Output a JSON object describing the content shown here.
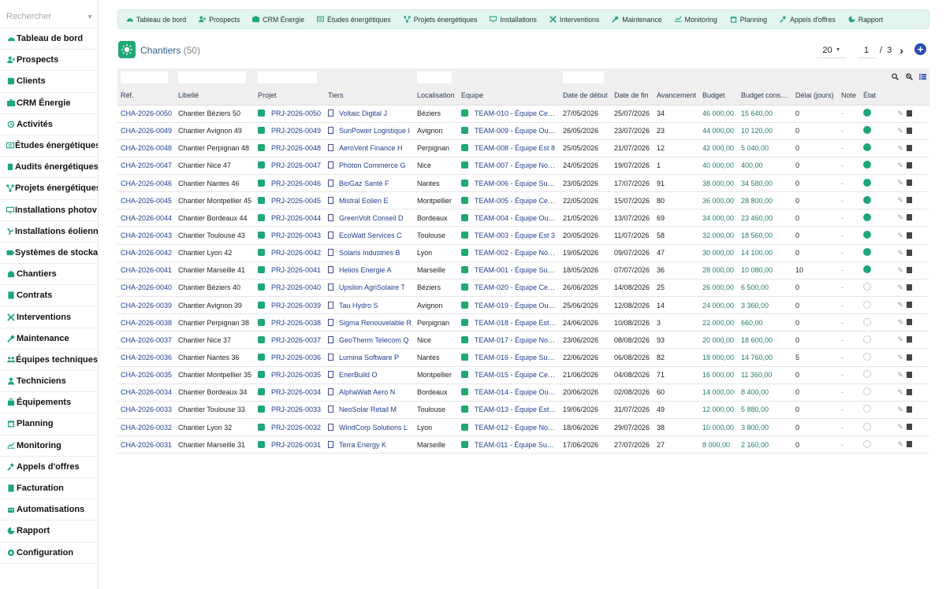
{
  "sidebar": {
    "search_placeholder": "Rechercher",
    "items": [
      {
        "label": "Tableau de bord",
        "icon": "dashboard-icon"
      },
      {
        "label": "Prospects",
        "icon": "user-plus-icon"
      },
      {
        "label": "Clients",
        "icon": "client-card-icon"
      },
      {
        "label": "CRM Énergie",
        "icon": "crm-icon"
      },
      {
        "label": "Activités",
        "icon": "history-icon"
      },
      {
        "label": "Études énergétiques",
        "icon": "study-icon"
      },
      {
        "label": "Audits énergétiques",
        "icon": "audit-icon"
      },
      {
        "label": "Projets énergétiques",
        "icon": "project-icon"
      },
      {
        "label": "Installations photov…",
        "icon": "solar-panel-icon"
      },
      {
        "label": "Installations éoliennes",
        "icon": "wind-icon"
      },
      {
        "label": "Systèmes de stockage",
        "icon": "battery-icon"
      },
      {
        "label": "Chantiers",
        "icon": "site-icon"
      },
      {
        "label": "Contrats",
        "icon": "contract-icon"
      },
      {
        "label": "Interventions",
        "icon": "tools-icon"
      },
      {
        "label": "Maintenance",
        "icon": "wrench-icon"
      },
      {
        "label": "Équipes techniques",
        "icon": "team-icon"
      },
      {
        "label": "Techniciens",
        "icon": "technician-icon"
      },
      {
        "label": "Équipements",
        "icon": "equipment-icon"
      },
      {
        "label": "Planning",
        "icon": "calendar-icon"
      },
      {
        "label": "Monitoring",
        "icon": "monitor-icon"
      },
      {
        "label": "Appels d'offres",
        "icon": "tender-icon"
      },
      {
        "label": "Facturation",
        "icon": "invoice-icon"
      },
      {
        "label": "Automatisations",
        "icon": "robot-icon"
      },
      {
        "label": "Rapport",
        "icon": "report-icon"
      },
      {
        "label": "Configuration",
        "icon": "gear-icon"
      }
    ]
  },
  "topmenu": [
    {
      "label": "Tableau de bord",
      "icon": "dashboard-icon"
    },
    {
      "label": "Prospects",
      "icon": "user-plus-icon"
    },
    {
      "label": "CRM Énergie",
      "icon": "crm-icon"
    },
    {
      "label": "Études énergétiques",
      "icon": "study-icon"
    },
    {
      "label": "Projets énergétiques",
      "icon": "project-icon"
    },
    {
      "label": "Installations",
      "icon": "solar-panel-icon"
    },
    {
      "label": "Interventions",
      "icon": "tools-icon"
    },
    {
      "label": "Maintenance",
      "icon": "wrench-icon"
    },
    {
      "label": "Monitoring",
      "icon": "monitor-icon"
    },
    {
      "label": "Planning",
      "icon": "calendar-icon"
    },
    {
      "label": "Appels d'offres",
      "icon": "tender-icon"
    },
    {
      "label": "Rapport",
      "icon": "report-icon"
    }
  ],
  "header": {
    "title": "Chantiers",
    "count": "(50)",
    "limit": "20",
    "page": "1",
    "page_sep": "/",
    "pages": "3"
  },
  "colors": {
    "accent": "#1fa774",
    "link": "#1f3f8f",
    "money": "#1d7f6d"
  },
  "table": {
    "columns": [
      "Réf.",
      "Libellé",
      "Projet",
      "Tiers",
      "Localisation",
      "Equipe",
      "Date de début",
      "Date de fin",
      "Avancement",
      "Budget",
      "Budget cons…",
      "Délai (jours)",
      "Note",
      "État"
    ],
    "rows": [
      {
        "ref": "CHA-2026-0050",
        "label": "Chantier Béziers 50",
        "project": "PRJ-2026-0050",
        "tiers": "Voltaic Digital J",
        "loc": "Béziers",
        "team": "TEAM-010 - Équipe Ce…",
        "start": "27/05/2026",
        "end": "25/07/2026",
        "progress": "34",
        "budget": "46 000,00",
        "consumed": "15 640,00",
        "delay": "0",
        "note": "-",
        "active": true
      },
      {
        "ref": "CHA-2026-0049",
        "label": "Chantier Avignon 49",
        "project": "PRJ-2026-0049",
        "tiers": "SunPower Logistique I",
        "loc": "Avignon",
        "team": "TEAM-009 - Équipe Ou…",
        "start": "26/05/2026",
        "end": "23/07/2026",
        "progress": "23",
        "budget": "44 000,00",
        "consumed": "10 120,00",
        "delay": "0",
        "note": "-",
        "active": true
      },
      {
        "ref": "CHA-2026-0048",
        "label": "Chantier Perpignan 48",
        "project": "PRJ-2026-0048",
        "tiers": "AeroVent Finance H",
        "loc": "Perpignan",
        "team": "TEAM-008 - Équipe Est 8",
        "start": "25/05/2026",
        "end": "21/07/2026",
        "progress": "12",
        "budget": "42 000,00",
        "consumed": "5 040,00",
        "delay": "0",
        "note": "-",
        "active": true
      },
      {
        "ref": "CHA-2026-0047",
        "label": "Chantier Nice 47",
        "project": "PRJ-2026-0047",
        "tiers": "Photon Commerce G",
        "loc": "Nice",
        "team": "TEAM-007 - Équipe No…",
        "start": "24/05/2026",
        "end": "19/07/2026",
        "progress": "1",
        "budget": "40 000,00",
        "consumed": "400,00",
        "delay": "0",
        "note": "-",
        "active": true
      },
      {
        "ref": "CHA-2026-0046",
        "label": "Chantier Nantes 46",
        "project": "PRJ-2026-0046",
        "tiers": "BioGaz Santé F",
        "loc": "Nantes",
        "team": "TEAM-006 - Équipe Su…",
        "start": "23/05/2026",
        "end": "17/07/2026",
        "progress": "91",
        "budget": "38 000,00",
        "consumed": "34 580,00",
        "delay": "0",
        "note": "-",
        "active": true
      },
      {
        "ref": "CHA-2026-0045",
        "label": "Chantier Montpellier 45",
        "project": "PRJ-2026-0045",
        "tiers": "Mistral Eolien E",
        "loc": "Montpellier",
        "team": "TEAM-005 - Équipe Ce…",
        "start": "22/05/2026",
        "end": "15/07/2026",
        "progress": "80",
        "budget": "36 000,00",
        "consumed": "28 800,00",
        "delay": "0",
        "note": "-",
        "active": true
      },
      {
        "ref": "CHA-2026-0044",
        "label": "Chantier Bordeaux 44",
        "project": "PRJ-2026-0044",
        "tiers": "GreenVolt Conseil D",
        "loc": "Bordeaux",
        "team": "TEAM-004 - Équipe Ou…",
        "start": "21/05/2026",
        "end": "13/07/2026",
        "progress": "69",
        "budget": "34 000,00",
        "consumed": "23 460,00",
        "delay": "0",
        "note": "-",
        "active": true
      },
      {
        "ref": "CHA-2026-0043",
        "label": "Chantier Toulouse 43",
        "project": "PRJ-2026-0043",
        "tiers": "EcoWatt Services C",
        "loc": "Toulouse",
        "team": "TEAM-003 - Équipe Est 3",
        "start": "20/05/2026",
        "end": "11/07/2026",
        "progress": "58",
        "budget": "32 000,00",
        "consumed": "18 560,00",
        "delay": "0",
        "note": "-",
        "active": true
      },
      {
        "ref": "CHA-2026-0042",
        "label": "Chantier Lyon 42",
        "project": "PRJ-2026-0042",
        "tiers": "Solaris Industries B",
        "loc": "Lyon",
        "team": "TEAM-002 - Équipe No…",
        "start": "19/05/2026",
        "end": "09/07/2026",
        "progress": "47",
        "budget": "30 000,00",
        "consumed": "14 100,00",
        "delay": "0",
        "note": "-",
        "active": true
      },
      {
        "ref": "CHA-2026-0041",
        "label": "Chantier Marseille 41",
        "project": "PRJ-2026-0041",
        "tiers": "Helios Energie A",
        "loc": "Marseille",
        "team": "TEAM-001 - Équipe Su…",
        "start": "18/05/2026",
        "end": "07/07/2026",
        "progress": "36",
        "budget": "28 000,00",
        "consumed": "10 080,00",
        "delay": "10",
        "note": "-",
        "active": true
      },
      {
        "ref": "CHA-2026-0040",
        "label": "Chantier Béziers 40",
        "project": "PRJ-2026-0040",
        "tiers": "Upsilon AgriSolaire T",
        "loc": "Béziers",
        "team": "TEAM-020 - Équipe Ce…",
        "start": "26/06/2026",
        "end": "14/08/2026",
        "progress": "25",
        "budget": "26 000,00",
        "consumed": "6 500,00",
        "delay": "0",
        "note": "-",
        "active": false
      },
      {
        "ref": "CHA-2026-0039",
        "label": "Chantier Avignon 39",
        "project": "PRJ-2026-0039",
        "tiers": "Tau Hydro S",
        "loc": "Avignon",
        "team": "TEAM-019 - Équipe Ou…",
        "start": "25/06/2026",
        "end": "12/08/2026",
        "progress": "14",
        "budget": "24 000,00",
        "consumed": "3 360,00",
        "delay": "0",
        "note": "-",
        "active": false
      },
      {
        "ref": "CHA-2026-0038",
        "label": "Chantier Perpignan 38",
        "project": "PRJ-2026-0038",
        "tiers": "Sigma Renouvelable R",
        "loc": "Perpignan",
        "team": "TEAM-018 - Équipe Est…",
        "start": "24/06/2026",
        "end": "10/08/2026",
        "progress": "3",
        "budget": "22 000,00",
        "consumed": "660,00",
        "delay": "0",
        "note": "-",
        "active": false
      },
      {
        "ref": "CHA-2026-0037",
        "label": "Chantier Nice 37",
        "project": "PRJ-2026-0037",
        "tiers": "GeoTherm Telecom Q",
        "loc": "Nice",
        "team": "TEAM-017 - Équipe No…",
        "start": "23/06/2026",
        "end": "08/08/2026",
        "progress": "93",
        "budget": "20 000,00",
        "consumed": "18 600,00",
        "delay": "0",
        "note": "-",
        "active": false
      },
      {
        "ref": "CHA-2026-0036",
        "label": "Chantier Nantes 36",
        "project": "PRJ-2026-0036",
        "tiers": "Lumina Software P",
        "loc": "Nantes",
        "team": "TEAM-016 - Équipe Su…",
        "start": "22/06/2026",
        "end": "06/08/2026",
        "progress": "82",
        "budget": "18 000,00",
        "consumed": "14 760,00",
        "delay": "5",
        "note": "-",
        "active": false
      },
      {
        "ref": "CHA-2026-0035",
        "label": "Chantier Montpellier 35",
        "project": "PRJ-2026-0035",
        "tiers": "EnerBuild O",
        "loc": "Montpellier",
        "team": "TEAM-015 - Équipe Ce…",
        "start": "21/06/2026",
        "end": "04/08/2026",
        "progress": "71",
        "budget": "16 000,00",
        "consumed": "11 360,00",
        "delay": "0",
        "note": "-",
        "active": false
      },
      {
        "ref": "CHA-2026-0034",
        "label": "Chantier Bordeaux 34",
        "project": "PRJ-2026-0034",
        "tiers": "AlphaWatt Aero N",
        "loc": "Bordeaux",
        "team": "TEAM-014 - Équipe Ou…",
        "start": "20/06/2026",
        "end": "02/08/2026",
        "progress": "60",
        "budget": "14 000,00",
        "consumed": "8 400,00",
        "delay": "0",
        "note": "-",
        "active": false
      },
      {
        "ref": "CHA-2026-0033",
        "label": "Chantier Toulouse 33",
        "project": "PRJ-2026-0033",
        "tiers": "NeoSolar Retail M",
        "loc": "Toulouse",
        "team": "TEAM-013 - Équipe Est…",
        "start": "19/06/2026",
        "end": "31/07/2026",
        "progress": "49",
        "budget": "12 000,00",
        "consumed": "5 880,00",
        "delay": "0",
        "note": "-",
        "active": false
      },
      {
        "ref": "CHA-2026-0032",
        "label": "Chantier Lyon 32",
        "project": "PRJ-2026-0032",
        "tiers": "WindCorp Solutions L",
        "loc": "Lyon",
        "team": "TEAM-012 - Équipe No…",
        "start": "18/06/2026",
        "end": "29/07/2026",
        "progress": "38",
        "budget": "10 000,00",
        "consumed": "3 800,00",
        "delay": "0",
        "note": "-",
        "active": false
      },
      {
        "ref": "CHA-2026-0031",
        "label": "Chantier Marseille 31",
        "project": "PRJ-2026-0031",
        "tiers": "Terra Energy K",
        "loc": "Marseille",
        "team": "TEAM-011 - Équipe Su…",
        "start": "17/06/2026",
        "end": "27/07/2026",
        "progress": "27",
        "budget": "8 000,00",
        "consumed": "2 160,00",
        "delay": "0",
        "note": "-",
        "active": false
      }
    ]
  }
}
